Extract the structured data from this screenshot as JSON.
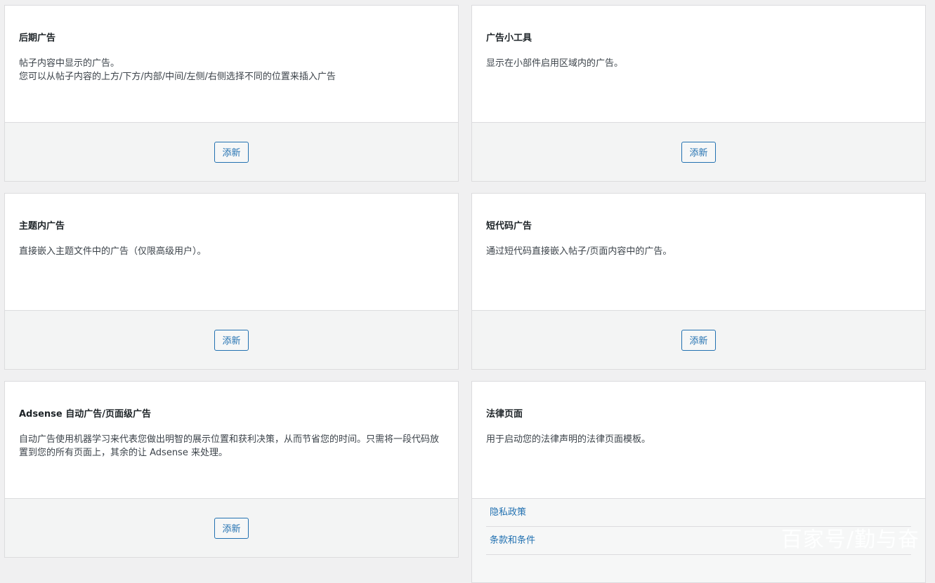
{
  "cards": [
    {
      "title": "后期广告",
      "desc_lines": [
        "帖子内容中显示的广告。",
        "您可以从帖子内容的上方/下方/内部/中间/左侧/右侧选择不同的位置来插入广告"
      ],
      "button": "添新"
    },
    {
      "title": "广告小工具",
      "desc_lines": [
        "显示在小部件启用区域内的广告。"
      ],
      "button": "添新"
    },
    {
      "title": "主题内广告",
      "desc_lines": [
        "直接嵌入主题文件中的广告（仅限高级用户）。"
      ],
      "button": "添新"
    },
    {
      "title": "短代码广告",
      "desc_lines": [
        "通过短代码直接嵌入帖子/页面内容中的广告。"
      ],
      "button": "添新"
    },
    {
      "title": "Adsense 自动广告/页面级广告",
      "desc_lines": [
        "自动广告使用机器学习来代表您做出明智的展示位置和获利决策，从而节省您的时间。只需将一段代码放",
        "置到您的所有页面上，其余的让 Adsense 来处理。"
      ],
      "button": "添新"
    },
    {
      "title": "法律页面",
      "desc_lines": [
        "用于启动您的法律声明的法律页面模板。"
      ],
      "links": [
        "隐私政策",
        "条款和条件"
      ]
    }
  ],
  "watermark": "百家号/勤与奋",
  "colors": {
    "accent": "#2271b1",
    "background": "#f0f0f1",
    "border": "#dcdcde"
  }
}
